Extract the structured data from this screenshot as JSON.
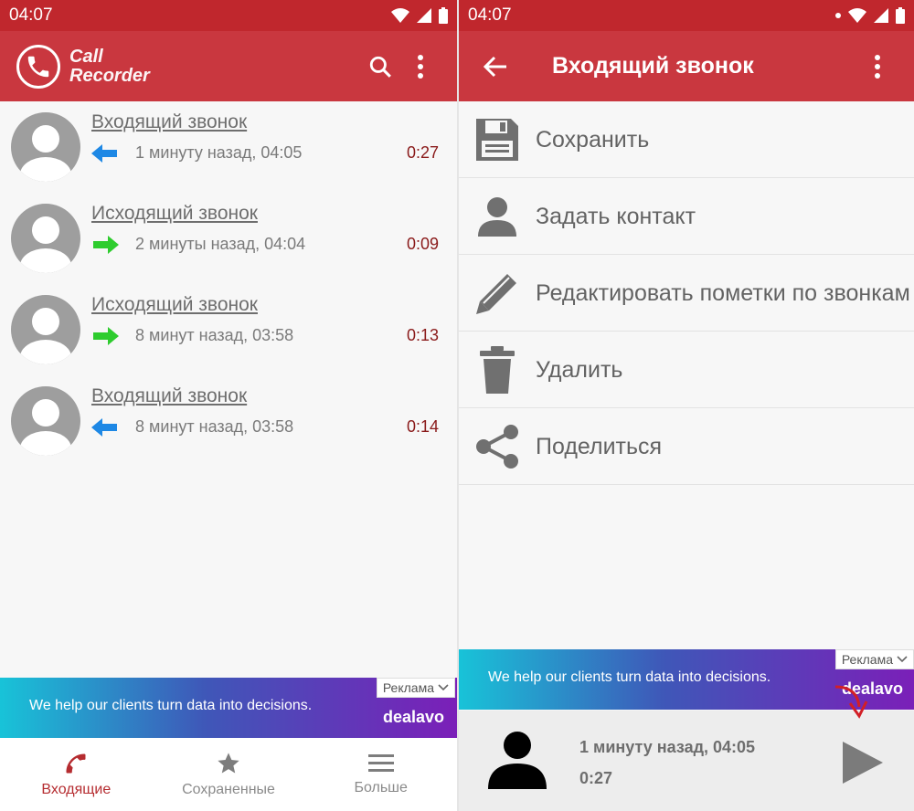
{
  "colors": {
    "status_bar": "#c0272d",
    "app_bar": "#c9373f",
    "accent": "#b52c30",
    "incoming_arrow": "#1e88e5",
    "outgoing_arrow": "#2ecc2e",
    "duration_text": "#8a1a1a"
  },
  "left": {
    "status_time": "04:07",
    "brand_line1": "Call",
    "brand_line2": "Recorder",
    "calls": [
      {
        "title": "Входящий звонок",
        "direction": "incoming",
        "meta": "1 минуту назад, 04:05",
        "duration": "0:27"
      },
      {
        "title": "Исходящий звонок",
        "direction": "outgoing",
        "meta": "2 минуты назад, 04:04",
        "duration": "0:09"
      },
      {
        "title": "Исходящий звонок",
        "direction": "outgoing",
        "meta": "8 минут назад, 03:58",
        "duration": "0:13"
      },
      {
        "title": "Входящий звонок",
        "direction": "incoming",
        "meta": "8 минут назад, 03:58",
        "duration": "0:14"
      }
    ],
    "ad": {
      "text": "We help our clients turn data into decisions.",
      "brand": "dealavo",
      "badge": "Реклама"
    },
    "nav": [
      {
        "label": "Входящие",
        "icon": "phone-icon",
        "active": true
      },
      {
        "label": "Сохраненные",
        "icon": "star-icon",
        "active": false
      },
      {
        "label": "Больше",
        "icon": "menu-icon",
        "active": false
      }
    ]
  },
  "right": {
    "status_time": "04:07",
    "title": "Входящий звонок",
    "menu": [
      {
        "label": "Сохранить",
        "icon": "floppy-disk-icon"
      },
      {
        "label": "Задать контакт",
        "icon": "person-icon"
      },
      {
        "label": "Редактировать пометки по звонкам",
        "icon": "pencil-icon"
      },
      {
        "label": "Удалить",
        "icon": "trash-icon"
      },
      {
        "label": "Поделиться",
        "icon": "share-icon"
      }
    ],
    "ad": {
      "text": "We help our clients turn data into decisions.",
      "brand": "dealavo",
      "badge": "Реклама"
    },
    "player": {
      "time": "1 минуту назад, 04:05",
      "duration": "0:27"
    }
  }
}
